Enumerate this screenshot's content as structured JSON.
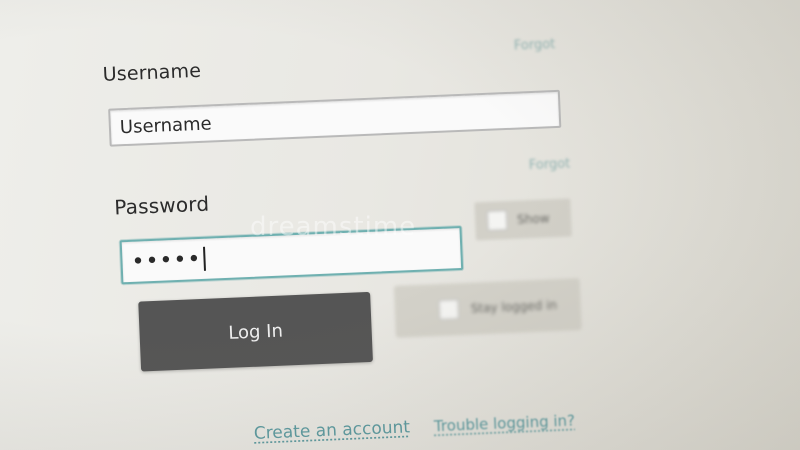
{
  "login_form": {
    "username_label": "Username",
    "username_help": "Forgot",
    "username_value": "Username",
    "password_label": "Password",
    "password_help": "Forgot",
    "password_value": "•••••",
    "show_label": "Show",
    "stay_logged_in_label": "Stay logged in",
    "login_button_label": "Log In",
    "create_account_link": "Create an account",
    "trouble_link": "Trouble logging in?"
  },
  "watermark": "dreamstime",
  "colors": {
    "background": "#e9e8e3",
    "button": "#555555",
    "link": "#5b9aa0",
    "focus_border": "#6fb0b0"
  }
}
